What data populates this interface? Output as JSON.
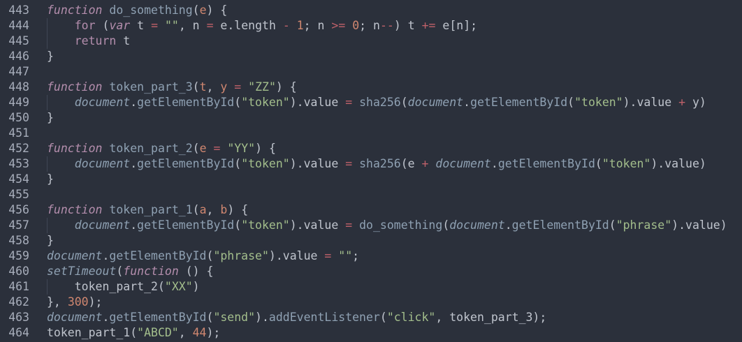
{
  "editor": {
    "theme_colors": {
      "background": "#2b303b",
      "keyword": "#b48ead",
      "function": "#8fa1b3",
      "string": "#a3be8c",
      "number": "#d08770",
      "operator": "#bf616a",
      "text": "#c0c5ce",
      "line_number": "#a7adba"
    },
    "lines": [
      {
        "num": "443",
        "tokens": [
          {
            "t": "function",
            "c": "storage"
          },
          {
            "t": " "
          },
          {
            "t": "do_something",
            "c": "func"
          },
          {
            "t": "("
          },
          {
            "t": "e",
            "c": "param"
          },
          {
            "t": ") {"
          }
        ]
      },
      {
        "num": "444",
        "tokens": [
          {
            "t": "    "
          },
          {
            "t": "for",
            "c": "keyword"
          },
          {
            "t": " ("
          },
          {
            "t": "var",
            "c": "storage"
          },
          {
            "t": " t "
          },
          {
            "t": "=",
            "c": "operator"
          },
          {
            "t": " "
          },
          {
            "t": "\"\"",
            "c": "string"
          },
          {
            "t": ", n "
          },
          {
            "t": "=",
            "c": "operator"
          },
          {
            "t": " e.length "
          },
          {
            "t": "-",
            "c": "operator"
          },
          {
            "t": " "
          },
          {
            "t": "1",
            "c": "number"
          },
          {
            "t": "; n "
          },
          {
            "t": ">=",
            "c": "operator"
          },
          {
            "t": " "
          },
          {
            "t": "0",
            "c": "number"
          },
          {
            "t": "; n"
          },
          {
            "t": "--",
            "c": "operator"
          },
          {
            "t": ") t "
          },
          {
            "t": "+=",
            "c": "operator"
          },
          {
            "t": " e[n];"
          }
        ]
      },
      {
        "num": "445",
        "tokens": [
          {
            "t": "    "
          },
          {
            "t": "return",
            "c": "keyword"
          },
          {
            "t": " t"
          }
        ]
      },
      {
        "num": "446",
        "tokens": [
          {
            "t": "}"
          }
        ]
      },
      {
        "num": "447",
        "tokens": []
      },
      {
        "num": "448",
        "tokens": [
          {
            "t": "function",
            "c": "storage"
          },
          {
            "t": " "
          },
          {
            "t": "token_part_3",
            "c": "func"
          },
          {
            "t": "("
          },
          {
            "t": "t",
            "c": "param"
          },
          {
            "t": ", "
          },
          {
            "t": "y",
            "c": "param"
          },
          {
            "t": " "
          },
          {
            "t": "=",
            "c": "operator"
          },
          {
            "t": " "
          },
          {
            "t": "\"ZZ\"",
            "c": "string"
          },
          {
            "t": ") {"
          }
        ]
      },
      {
        "num": "449",
        "tokens": [
          {
            "t": "    "
          },
          {
            "t": "document",
            "c": "builtin"
          },
          {
            "t": "."
          },
          {
            "t": "getElementById",
            "c": "func"
          },
          {
            "t": "("
          },
          {
            "t": "\"token\"",
            "c": "string"
          },
          {
            "t": ").value "
          },
          {
            "t": "=",
            "c": "operator"
          },
          {
            "t": " "
          },
          {
            "t": "sha256",
            "c": "func"
          },
          {
            "t": "("
          },
          {
            "t": "document",
            "c": "builtin"
          },
          {
            "t": "."
          },
          {
            "t": "getElementById",
            "c": "func"
          },
          {
            "t": "("
          },
          {
            "t": "\"token\"",
            "c": "string"
          },
          {
            "t": ").value "
          },
          {
            "t": "+",
            "c": "operator"
          },
          {
            "t": " y)"
          }
        ]
      },
      {
        "num": "450",
        "tokens": [
          {
            "t": "}"
          }
        ]
      },
      {
        "num": "451",
        "tokens": []
      },
      {
        "num": "452",
        "tokens": [
          {
            "t": "function",
            "c": "storage"
          },
          {
            "t": " "
          },
          {
            "t": "token_part_2",
            "c": "func"
          },
          {
            "t": "("
          },
          {
            "t": "e",
            "c": "param"
          },
          {
            "t": " "
          },
          {
            "t": "=",
            "c": "operator"
          },
          {
            "t": " "
          },
          {
            "t": "\"YY\"",
            "c": "string"
          },
          {
            "t": ") {"
          }
        ]
      },
      {
        "num": "453",
        "tokens": [
          {
            "t": "    "
          },
          {
            "t": "document",
            "c": "builtin"
          },
          {
            "t": "."
          },
          {
            "t": "getElementById",
            "c": "func"
          },
          {
            "t": "("
          },
          {
            "t": "\"token\"",
            "c": "string"
          },
          {
            "t": ").value "
          },
          {
            "t": "=",
            "c": "operator"
          },
          {
            "t": " "
          },
          {
            "t": "sha256",
            "c": "func"
          },
          {
            "t": "(e "
          },
          {
            "t": "+",
            "c": "operator"
          },
          {
            "t": " "
          },
          {
            "t": "document",
            "c": "builtin"
          },
          {
            "t": "."
          },
          {
            "t": "getElementById",
            "c": "func"
          },
          {
            "t": "("
          },
          {
            "t": "\"token\"",
            "c": "string"
          },
          {
            "t": ").value)"
          }
        ]
      },
      {
        "num": "454",
        "tokens": [
          {
            "t": "}"
          }
        ]
      },
      {
        "num": "455",
        "tokens": []
      },
      {
        "num": "456",
        "tokens": [
          {
            "t": "function",
            "c": "storage"
          },
          {
            "t": " "
          },
          {
            "t": "token_part_1",
            "c": "func"
          },
          {
            "t": "("
          },
          {
            "t": "a",
            "c": "param"
          },
          {
            "t": ", "
          },
          {
            "t": "b",
            "c": "param"
          },
          {
            "t": ") {"
          }
        ]
      },
      {
        "num": "457",
        "tokens": [
          {
            "t": "    "
          },
          {
            "t": "document",
            "c": "builtin"
          },
          {
            "t": "."
          },
          {
            "t": "getElementById",
            "c": "func"
          },
          {
            "t": "("
          },
          {
            "t": "\"token\"",
            "c": "string"
          },
          {
            "t": ").value "
          },
          {
            "t": "=",
            "c": "operator"
          },
          {
            "t": " "
          },
          {
            "t": "do_something",
            "c": "func"
          },
          {
            "t": "("
          },
          {
            "t": "document",
            "c": "builtin"
          },
          {
            "t": "."
          },
          {
            "t": "getElementById",
            "c": "func"
          },
          {
            "t": "("
          },
          {
            "t": "\"phrase\"",
            "c": "string"
          },
          {
            "t": ").value)"
          }
        ]
      },
      {
        "num": "458",
        "tokens": [
          {
            "t": "}"
          }
        ]
      },
      {
        "num": "459",
        "tokens": [
          {
            "t": "document",
            "c": "builtin"
          },
          {
            "t": "."
          },
          {
            "t": "getElementById",
            "c": "func"
          },
          {
            "t": "("
          },
          {
            "t": "\"phrase\"",
            "c": "string"
          },
          {
            "t": ").value "
          },
          {
            "t": "=",
            "c": "operator"
          },
          {
            "t": " "
          },
          {
            "t": "\"\"",
            "c": "string"
          },
          {
            "t": ";"
          }
        ]
      },
      {
        "num": "460",
        "tokens": [
          {
            "t": "setTimeout",
            "c": "builtin"
          },
          {
            "t": "("
          },
          {
            "t": "function",
            "c": "storage"
          },
          {
            "t": " () {"
          }
        ]
      },
      {
        "num": "461",
        "tokens": [
          {
            "t": "    token_part_2("
          },
          {
            "t": "\"XX\"",
            "c": "string"
          },
          {
            "t": ")"
          }
        ]
      },
      {
        "num": "462",
        "tokens": [
          {
            "t": "}, "
          },
          {
            "t": "300",
            "c": "number"
          },
          {
            "t": ");"
          }
        ]
      },
      {
        "num": "463",
        "tokens": [
          {
            "t": "document",
            "c": "builtin"
          },
          {
            "t": "."
          },
          {
            "t": "getElementById",
            "c": "func"
          },
          {
            "t": "("
          },
          {
            "t": "\"send\"",
            "c": "string"
          },
          {
            "t": ")."
          },
          {
            "t": "addEventListener",
            "c": "func"
          },
          {
            "t": "("
          },
          {
            "t": "\"click\"",
            "c": "string"
          },
          {
            "t": ", token_part_3);"
          }
        ]
      },
      {
        "num": "464",
        "tokens": [
          {
            "t": "token_part_1("
          },
          {
            "t": "\"ABCD\"",
            "c": "string"
          },
          {
            "t": ", "
          },
          {
            "t": "44",
            "c": "number"
          },
          {
            "t": ");"
          }
        ]
      }
    ]
  }
}
